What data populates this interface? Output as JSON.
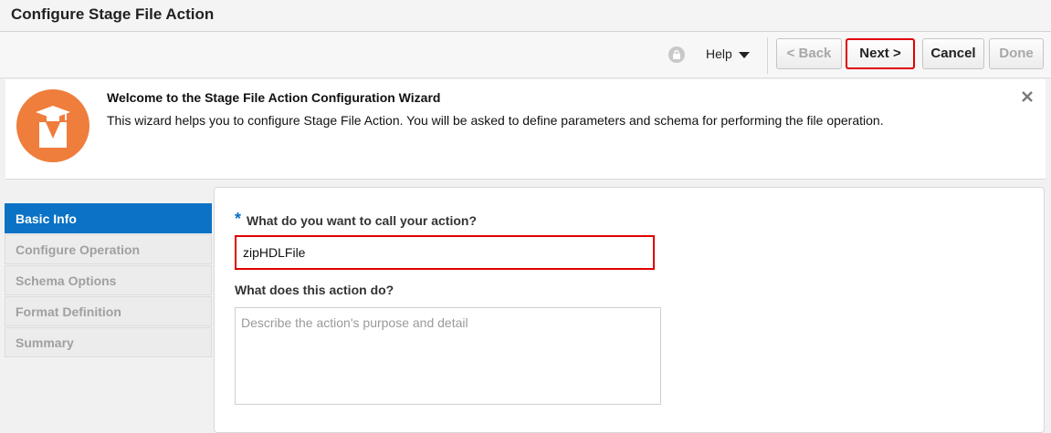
{
  "header": {
    "title": "Configure Stage File Action"
  },
  "toolbar": {
    "help_label": "Help",
    "back_label": "< Back",
    "next_label": "Next >",
    "cancel_label": "Cancel",
    "done_label": "Done"
  },
  "banner": {
    "heading": "Welcome to the Stage File Action Configuration Wizard",
    "description": "This wizard helps you to configure Stage File Action. You will be asked to define parameters and schema for performing the file operation.",
    "icon": "graduate-icon"
  },
  "nav": {
    "items": [
      {
        "label": "Basic Info",
        "active": true
      },
      {
        "label": "Configure Operation",
        "active": false
      },
      {
        "label": "Schema Options",
        "active": false
      },
      {
        "label": "Format Definition",
        "active": false
      },
      {
        "label": "Summary",
        "active": false
      }
    ]
  },
  "form": {
    "required_marker": "*",
    "name_label": "What do you want to call your action?",
    "name_value": "zipHDLFile",
    "desc_label": "What does this action do?",
    "desc_placeholder": "Describe the action's purpose and detail"
  },
  "colors": {
    "accent": "#0b72c5",
    "highlight": "#e00000",
    "wizard_icon": "#ef7d3c"
  }
}
